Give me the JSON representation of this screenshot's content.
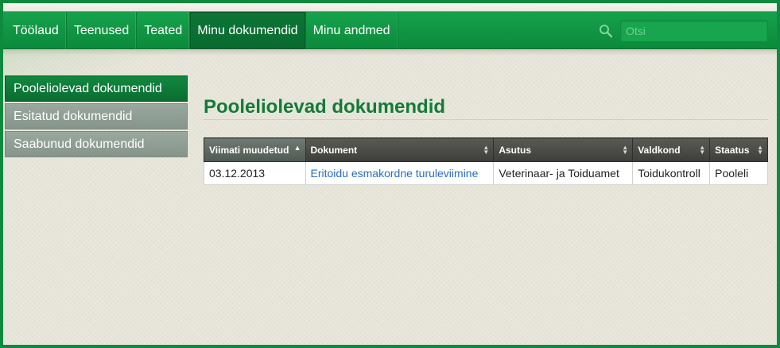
{
  "nav": {
    "items": [
      {
        "label": "Töölaud"
      },
      {
        "label": "Teenused"
      },
      {
        "label": "Teated"
      },
      {
        "label": "Minu dokumendid",
        "active": true
      },
      {
        "label": "Minu andmed"
      }
    ],
    "search": {
      "placeholder": "Otsi",
      "value": "",
      "icon": "search-icon"
    }
  },
  "sidebar": {
    "items": [
      {
        "label": "Pooleliolevad dokumendid",
        "active": true
      },
      {
        "label": "Esitatud dokumendid"
      },
      {
        "label": "Saabunud dokumendid"
      }
    ]
  },
  "main": {
    "title": "Pooleliolevad dokumendid",
    "table": {
      "headers": [
        "Viimati muudetud",
        "Dokument",
        "Asutus",
        "Valdkond",
        "Staatus"
      ],
      "sorted_column": 0,
      "sort_direction": "asc",
      "rows": [
        {
          "date": "03.12.2013",
          "document": "Eritoidu esmakordne turuleviimine",
          "institution": "Veterinaar- ja Toiduamet",
          "field": "Toidukontroll",
          "status": "Pooleli"
        }
      ]
    }
  },
  "colors": {
    "brand_green": "#0e8a3e",
    "title_green": "#137a3a",
    "link_blue": "#2a6ebb",
    "sidebar_inactive": "#8f9d94"
  }
}
